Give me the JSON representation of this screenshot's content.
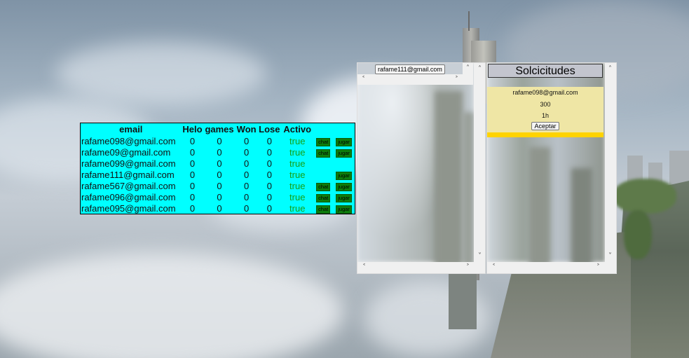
{
  "users_table": {
    "headers": [
      "email",
      "Helo",
      "games",
      "Won",
      "Lose",
      "Activo"
    ],
    "rows": [
      {
        "email": "rafame098@gmail.com",
        "helo": "0",
        "games": "0",
        "won": "0",
        "lose": "0",
        "activo": "true",
        "chat": "chat",
        "jugar": "jugar"
      },
      {
        "email": "rafame09@gmail.com",
        "helo": "0",
        "games": "0",
        "won": "0",
        "lose": "0",
        "activo": "true",
        "chat": "chat",
        "jugar": "jugar"
      },
      {
        "email": "rafame099@gmail.com",
        "helo": "0",
        "games": "0",
        "won": "0",
        "lose": "0",
        "activo": "true",
        "chat": "",
        "jugar": ""
      },
      {
        "email": "rafame111@gmail.com",
        "helo": "0",
        "games": "0",
        "won": "0",
        "lose": "0",
        "activo": "true",
        "chat": "",
        "jugar": "jugar"
      },
      {
        "email": "rafame567@gmail.com",
        "helo": "0",
        "games": "0",
        "won": "0",
        "lose": "0",
        "activo": "true",
        "chat": "chat",
        "jugar": "jugar"
      },
      {
        "email": "rafame096@gmail.com",
        "helo": "0",
        "games": "0",
        "won": "0",
        "lose": "0",
        "activo": "true",
        "chat": "chat",
        "jugar": "jugar"
      },
      {
        "email": "rafame095@gmail.com",
        "helo": "0",
        "games": "0",
        "won": "0",
        "lose": "0",
        "activo": "true",
        "chat": "chat",
        "jugar": "jugar"
      }
    ]
  },
  "chat_panel": {
    "email_tag": "rafame111@gmail.com"
  },
  "requests_panel": {
    "title": "Solcicitudes",
    "request": {
      "email": "rafame098@gmail.com",
      "amount": "300",
      "duration": "1h",
      "accept_label": "Aceptar"
    }
  },
  "icons": {
    "scroll_up": "chevron-up-icon",
    "scroll_down": "chevron-down-icon",
    "scroll_left": "chevron-left-icon",
    "scroll_right": "chevron-right-icon"
  },
  "colors": {
    "table_bg": "#00ffff",
    "activo_text": "#16a016",
    "action_button": "#0d7d0d",
    "request_card": "#efe6a5",
    "request_card_border": "#ffd300",
    "panel_header": "#c3c5ce"
  }
}
